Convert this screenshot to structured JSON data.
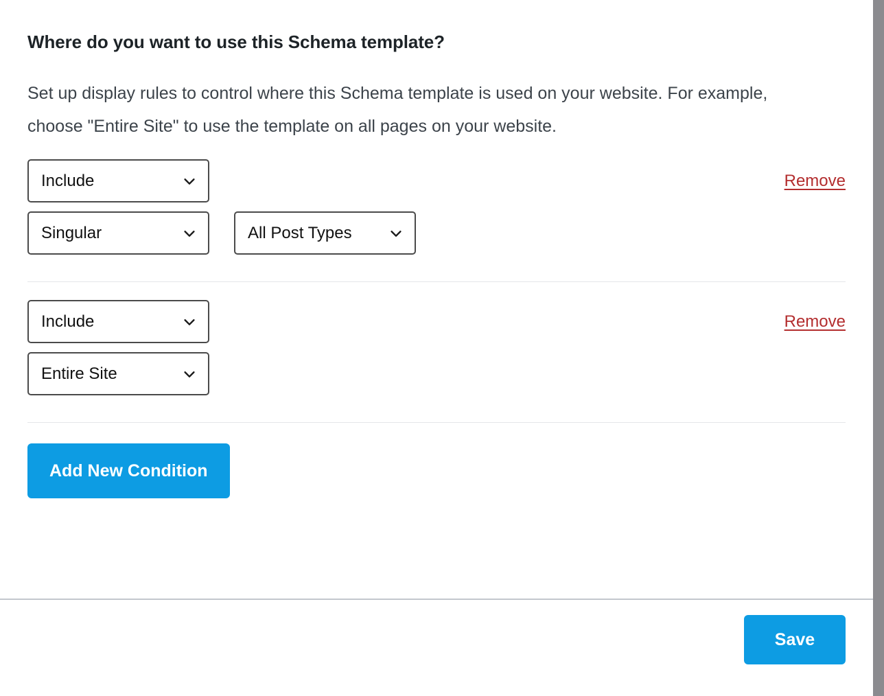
{
  "panel": {
    "title": "Where do you want to use this Schema template?",
    "description": "Set up display rules to control where this Schema template is used on your website. For example, choose \"Entire Site\" to use the template on all pages on your website."
  },
  "conditions": [
    {
      "inclusion": "Include",
      "scope": "Singular",
      "target": "All Post Types",
      "remove_label": "Remove"
    },
    {
      "inclusion": "Include",
      "scope": "Entire Site",
      "remove_label": "Remove"
    }
  ],
  "actions": {
    "add_condition_label": "Add New Condition",
    "save_label": "Save"
  },
  "icons": {
    "chevron_down": "chevron-down-icon"
  },
  "colors": {
    "primary_blue": "#0d9ce3",
    "remove_red": "#b32d2e",
    "title_text": "#1d2327",
    "body_text": "#3c434a",
    "select_border": "#4a4a4a",
    "divider": "#e4e6e9",
    "footer_divider": "#c3c7cd",
    "scrollbar": "#8b8b8f"
  }
}
